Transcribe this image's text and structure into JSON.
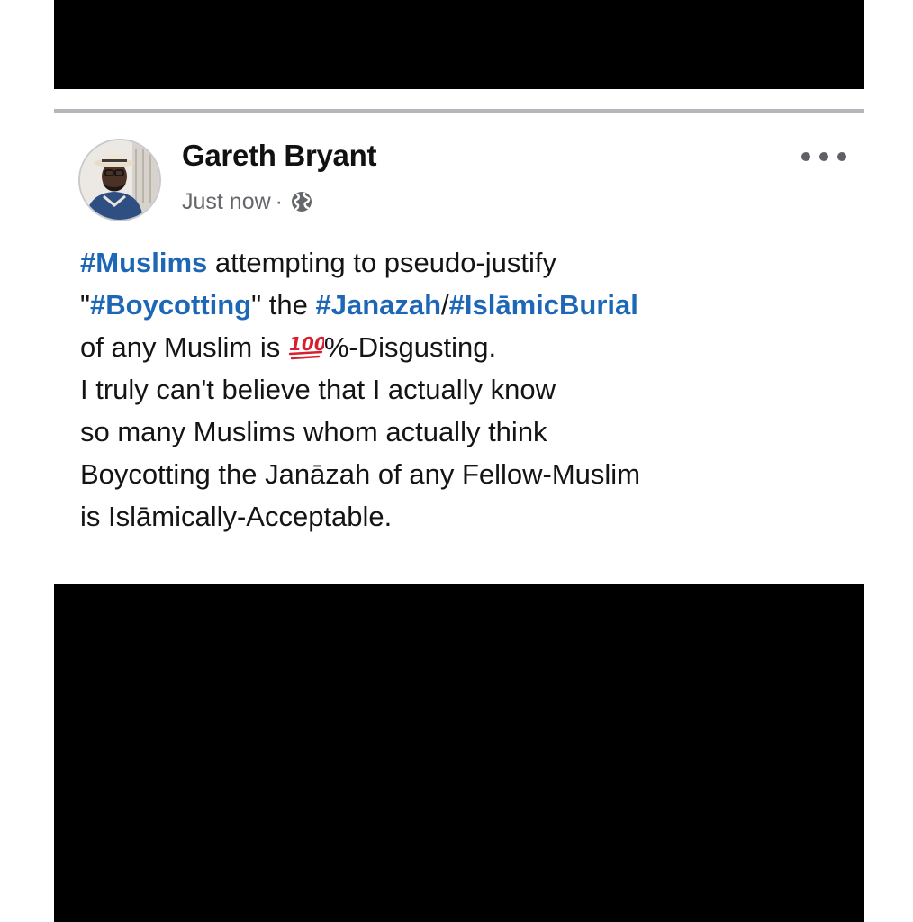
{
  "post": {
    "author": "Gareth Bryant",
    "timestamp": "Just now",
    "separator": "·",
    "privacy_icon": "globe-icon",
    "more_icon": "more-options-icon",
    "avatar_icon": "profile-photo",
    "body": {
      "line1": {
        "tag": "#Muslims",
        "text": " attempting to pseudo-justify"
      },
      "line2": {
        "q1": "\"",
        "tag1": "#Boycotting",
        "text1": "\" the ",
        "tag2": "#Janazah",
        "slash": "/",
        "tag3": "#IslāmicBurial"
      },
      "line3": {
        "text1": "of any Muslim is ",
        "emoji": "💯",
        "text2": "%-Disgusting."
      },
      "line4": "I truly can't believe that I actually know",
      "line5": "so many Muslims whom actually think",
      "line6": "Boycotting the Janāzah of any Fellow-Muslim",
      "line7": "is Islāmically-Acceptable."
    }
  },
  "colors": {
    "hashtag": "#1d67b6",
    "text": "#141414",
    "meta": "#65676b",
    "bars": "#000000"
  }
}
